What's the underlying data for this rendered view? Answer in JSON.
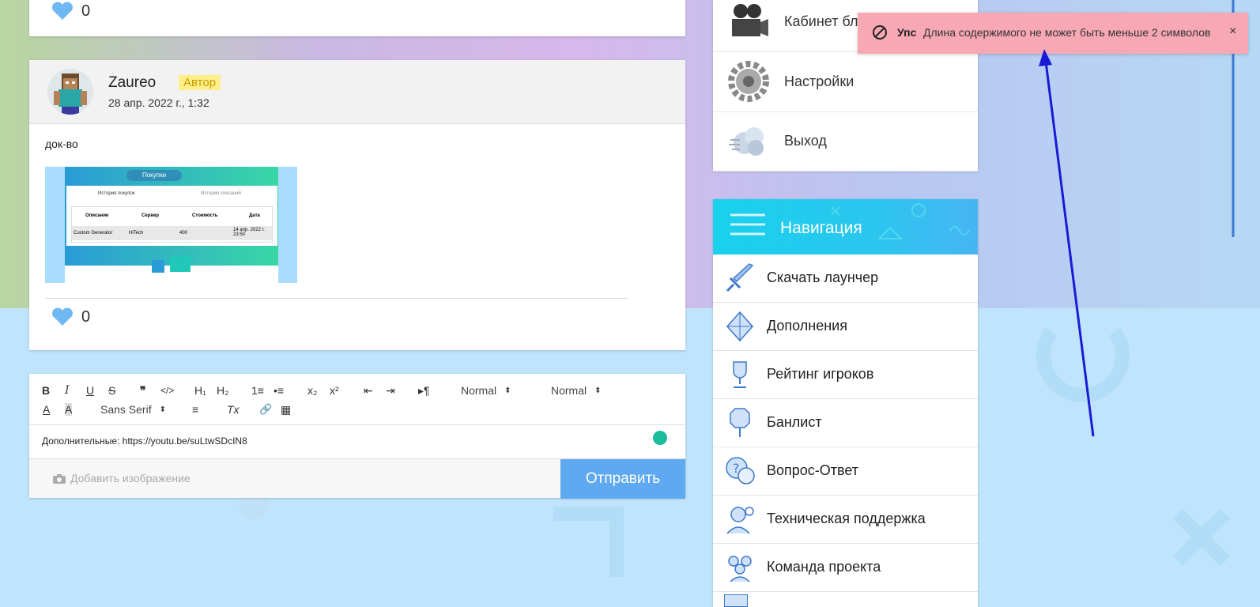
{
  "previous_post": {
    "likes": "0"
  },
  "post": {
    "author": "Zaureo",
    "badge": "Автор",
    "date": "28 апр. 2022 г., 1:32",
    "text": "док-во",
    "likes": "0",
    "screenshot": {
      "header_label": "Покупки",
      "tabs": [
        "История покупок",
        "История списаний"
      ],
      "columns": [
        "Описание",
        "Сервер",
        "Стоимость",
        "Дата"
      ],
      "row": [
        "Custom Generator",
        "HiTech",
        "400",
        "14 апр. 2022 г. 23:50"
      ]
    }
  },
  "editor": {
    "toolbar": {
      "bold": "B",
      "italic": "I",
      "underline": "U",
      "strike": "S",
      "quote": "❞",
      "code": "</>",
      "h1": "H₁",
      "h2": "H₂",
      "ordered_list": "1≡",
      "bullet_list": "•≡",
      "sub": "x₂",
      "sup": "x²",
      "outdent": "⇤",
      "indent": "⇥",
      "direction": "▸¶",
      "size_select": "Normal",
      "header_select": "Normal",
      "color": "A",
      "background": "A",
      "font_select": "Sans Serif",
      "align": "≡",
      "clean": "Tx",
      "link": "🔗",
      "video": "▦"
    },
    "content": "Дополнительные: https://youtu.be/suLtwSDcIN8",
    "add_image": "Добавить изображение",
    "submit": "Отправить"
  },
  "menu_top": {
    "items": [
      {
        "label": "Кабинет блогера",
        "icon": "camera-icon"
      },
      {
        "label": "Настройки",
        "icon": "gear-icon"
      },
      {
        "label": "Выход",
        "icon": "smoke-icon"
      }
    ]
  },
  "navigation": {
    "title": "Навигация",
    "items": [
      {
        "label": "Скачать лаунчер",
        "icon": "sword-icon"
      },
      {
        "label": "Дополнения",
        "icon": "diamond-icon"
      },
      {
        "label": "Рейтинг игроков",
        "icon": "trophy-icon"
      },
      {
        "label": "Банлист",
        "icon": "ban-sign-icon"
      },
      {
        "label": "Вопрос-Ответ",
        "icon": "question-bubble-icon"
      },
      {
        "label": "Техническая поддержка",
        "icon": "support-icon"
      },
      {
        "label": "Команда проекта",
        "icon": "team-icon"
      }
    ]
  },
  "toast": {
    "title": "Упс",
    "message": "Длина содержимого не может быть меньше 2 символов",
    "close": "×"
  },
  "colors": {
    "accent": "#5ea9ef",
    "toast_bg": "#f7a8b4",
    "badge_bg": "#ffef8a",
    "heart": "#6fb8f2",
    "nav_head": "#19d1ec",
    "annotation_arrow": "#1a1ad6"
  }
}
